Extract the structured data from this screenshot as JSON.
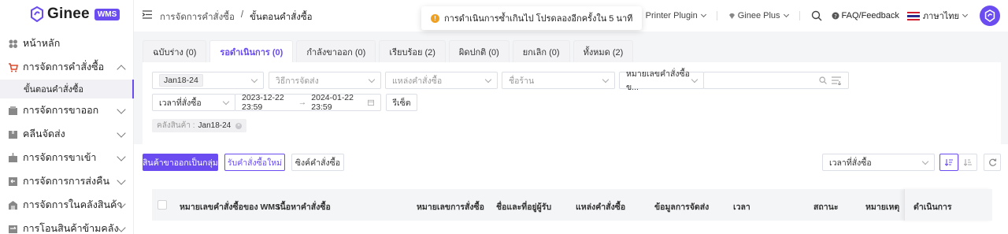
{
  "brand": {
    "name": "Ginee",
    "badge": "WMS",
    "accent": "#6a4cf0"
  },
  "sidebar": {
    "items": [
      {
        "label": "หน้าหลัก",
        "icon": "dashboard-icon"
      },
      {
        "label": "การจัดการคำสั่งซื้อ",
        "icon": "cart-icon",
        "expanded": true
      },
      {
        "label": "การจัดการขาออก",
        "icon": "box-icon"
      },
      {
        "label": "คลีนจัดส่ง",
        "icon": "package-icon"
      },
      {
        "label": "การจัดการขาเข้า",
        "icon": "inbound-icon"
      },
      {
        "label": "การจัดการการส่งคืน",
        "icon": "return-icon"
      },
      {
        "label": "การจัดการในคลังสินค้า",
        "icon": "warehouse-icon"
      },
      {
        "label": "การโอนสินค้าข้ามคลัง",
        "icon": "transfer-icon"
      }
    ],
    "sub_item": "ขั้นตอนคำสั่งซื้อ"
  },
  "header": {
    "breadcrumb": [
      "การจัดการคำสั่งซื้อ",
      "ขั้นตอนคำสั่งซื้อ"
    ],
    "toast": "การดำเนินการซ้ำเกินไป โปรดลองอีกครั้งใน 5 นาที",
    "printer_plugin": "Printer Plugin",
    "ginee_plus": "Ginee Plus",
    "faq": "FAQ/Feedback",
    "language": "ภาษาไทย"
  },
  "tabs": [
    {
      "label": "ฉบับร่าง (0)",
      "active": false
    },
    {
      "label": "รอดำเนินการ (0)",
      "active": true
    },
    {
      "label": "กำลังขาออก (0)",
      "active": false
    },
    {
      "label": "เรียบร้อย (2)",
      "active": false
    },
    {
      "label": "ผิดปกติ (0)",
      "active": false
    },
    {
      "label": "ยกเลิก (0)",
      "active": false
    },
    {
      "label": "ทั้งหมด (2)",
      "active": false
    }
  ],
  "filters": {
    "warehouse_chip": "Jan18-24",
    "shipping_placeholder": "วิธีการจัดส่ง",
    "source_placeholder": "แหล่งคำสั่งซื้อ",
    "shop_placeholder": "ชื่อร้าน",
    "order_no_select": "หมายเลขคำสั่งซื้อข...",
    "time_select": "เวลาที่สั่งซื้อ",
    "date_start": "2023-12-22 23:59",
    "date_sep": "→",
    "date_end": "2024-01-22 23:59",
    "reset": "รีเซ็ต",
    "tag_label": "คลังสินค้า :",
    "tag_value": "Jan18-24"
  },
  "actions": {
    "bulk_outbound": "สินค้าขาออกเป็นกลุ่ม",
    "receive_new": "รับคำสั่งซื้อใหม่",
    "sync": "ซิงค์คำสั่งซื้อ",
    "sort_select": "เวลาที่สั่งซื้อ"
  },
  "table": {
    "columns": [
      "หมายเลขคำสั่งซื้อของ WMS",
      "เนื้อหาคำสั่งซื้อ",
      "หมายเลขการสั่งซื้อ",
      "ชื่อและที่อยู่ผู้รับ",
      "แหล่งคำสั่งซื้อ",
      "ข้อมูลการจัดส่ง",
      "เวลา",
      "สถานะ",
      "หมายเหตุ",
      "ดำเนินการ"
    ]
  }
}
